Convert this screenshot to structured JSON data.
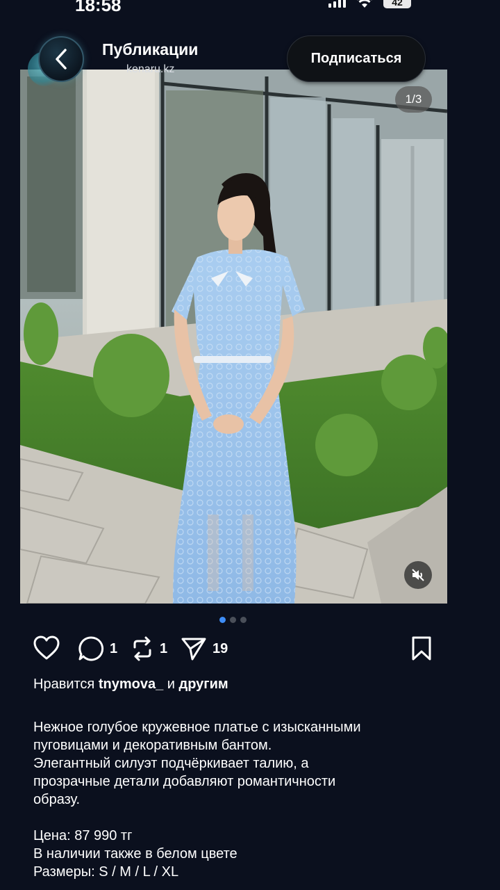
{
  "status_bar": {
    "time": "18:58",
    "battery": "42"
  },
  "header": {
    "title": "Публикации",
    "subtitle": "kenaru.kz",
    "subscribe_label": "Подписаться"
  },
  "media": {
    "counter": "1/3",
    "dots_total": 3,
    "dots_active": 1
  },
  "actions": {
    "comments_count": "1",
    "reposts_count": "1",
    "shares_count": "19"
  },
  "likes": {
    "prefix": "Нравится",
    "user": "tnymova_",
    "conjunction": "и",
    "others": "другим"
  },
  "caption": {
    "lines": [
      "Нежное голубое кружевное платье с изысканными",
      "пуговицами и декоративным бантом.",
      "Элегантный силуэт подчёркивает талию, а",
      "прозрачные детали добавляют романтичности",
      "образу."
    ],
    "details": [
      "Цена: 87 990 тг",
      "В наличии также в белом цвете",
      "Размеры: S / M / L / XL"
    ]
  },
  "colors": {
    "background": "#0b101e",
    "accent_dot": "#3e8df7"
  }
}
